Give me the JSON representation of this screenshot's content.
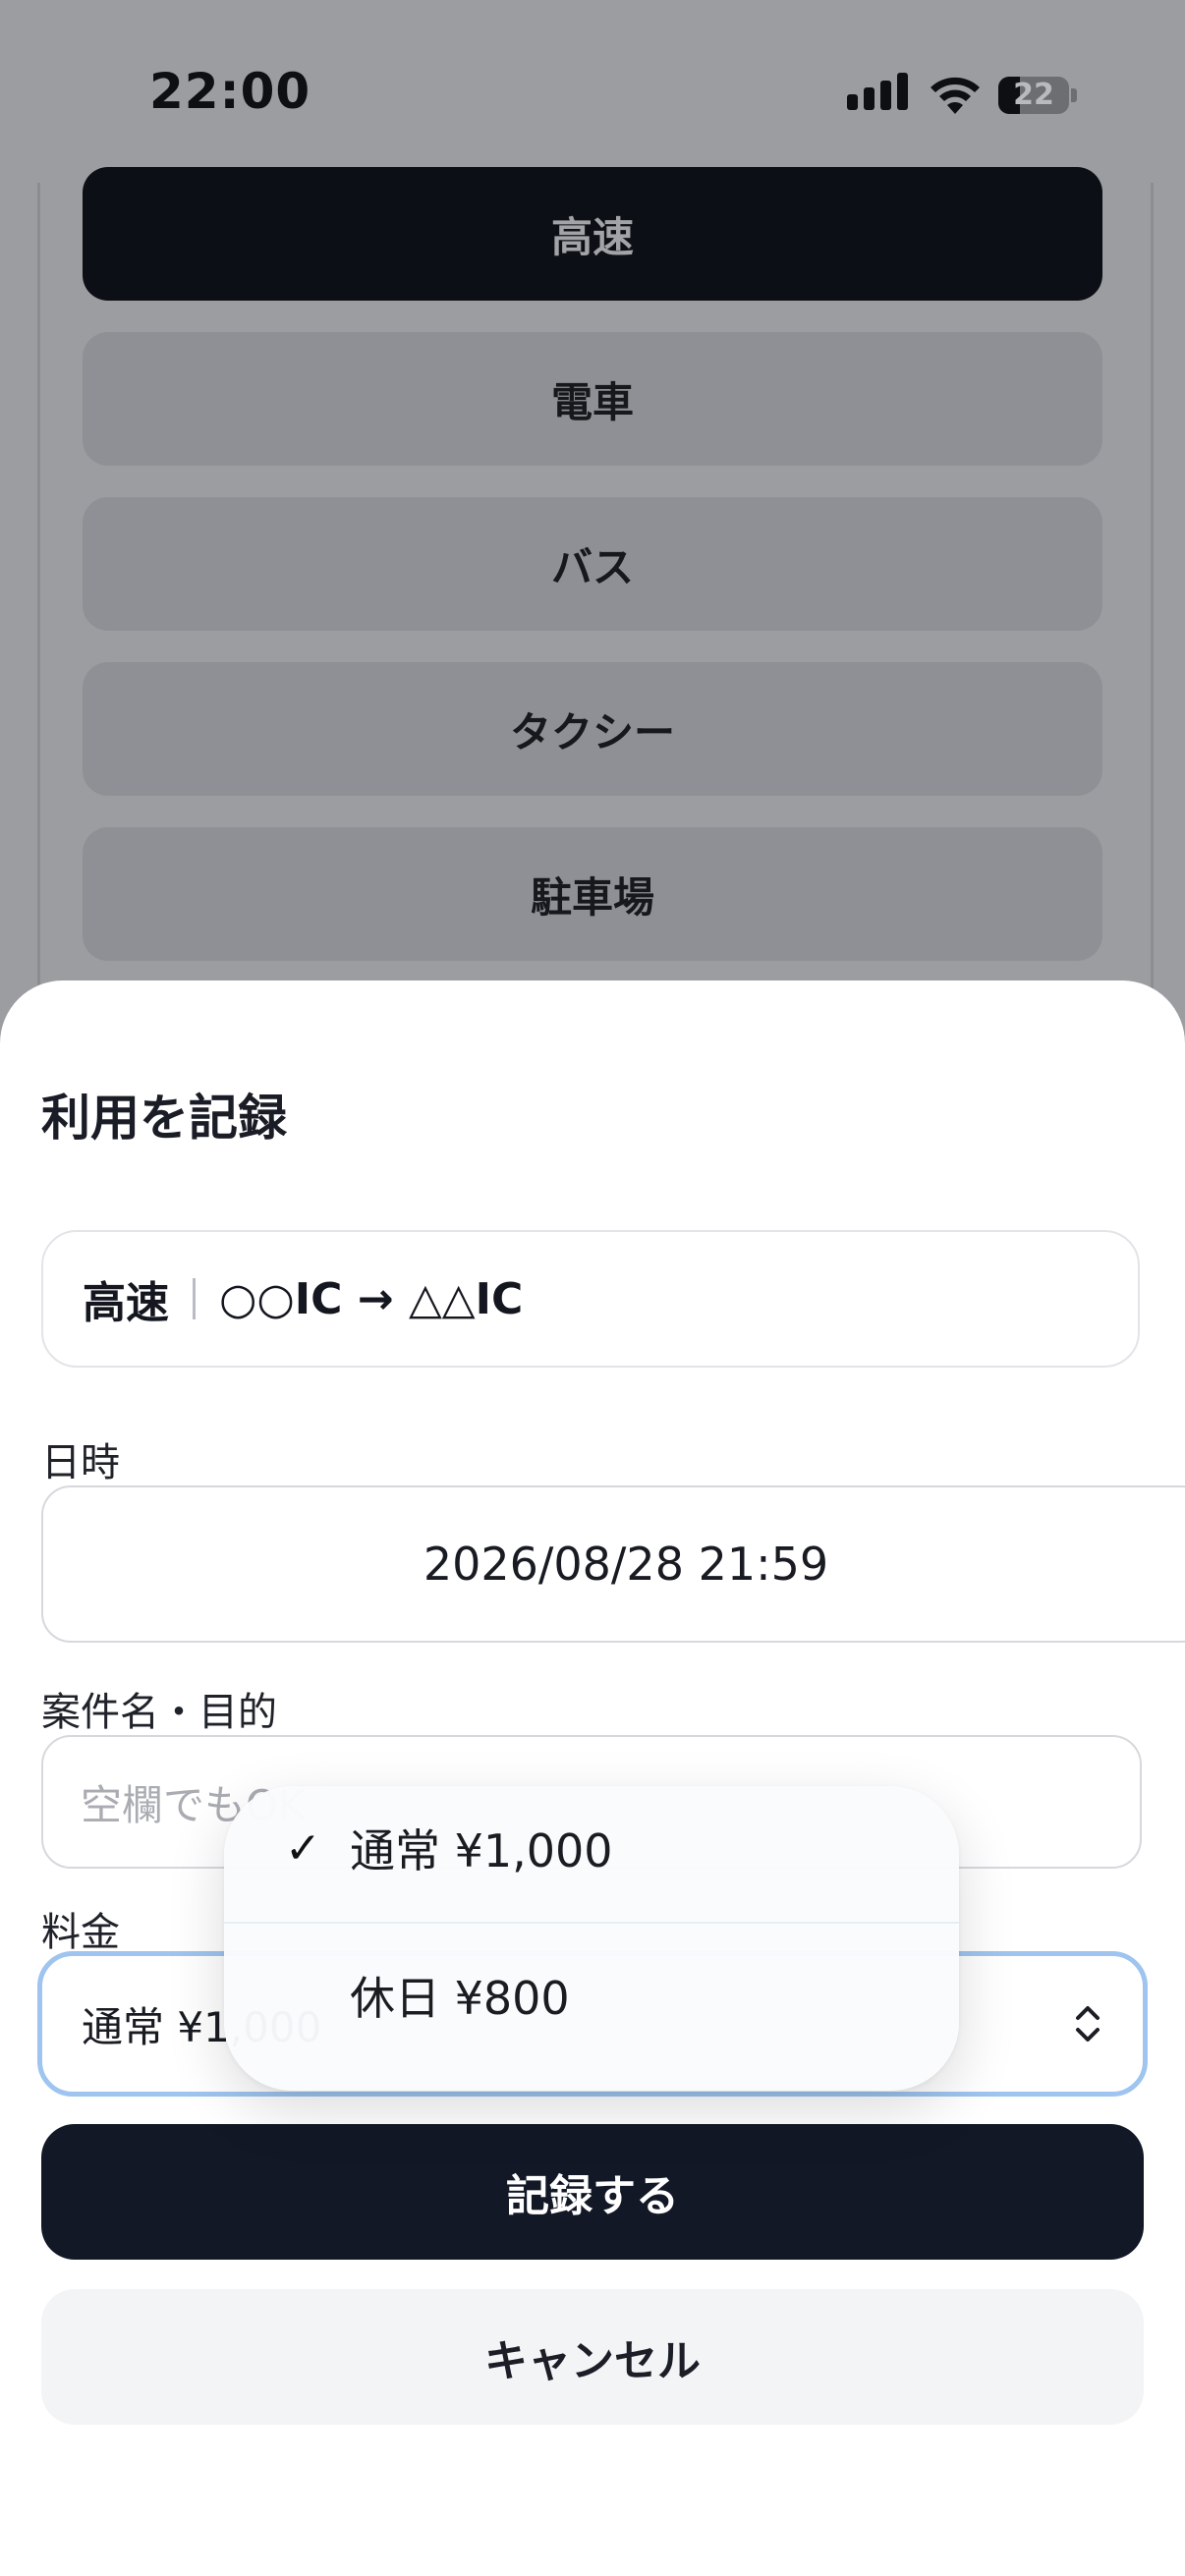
{
  "status_bar": {
    "time": "22:00",
    "battery_level": "22",
    "icons": [
      "signal-icon",
      "wifi-icon",
      "battery-icon"
    ]
  },
  "background": {
    "mode_buttons": [
      {
        "label": "高速",
        "active": true
      },
      {
        "label": "電車",
        "active": false
      },
      {
        "label": "バス",
        "active": false
      },
      {
        "label": "タクシー",
        "active": false
      },
      {
        "label": "駐車場",
        "active": false
      }
    ]
  },
  "sheet": {
    "title": "利用を記録",
    "route": {
      "type": "高速",
      "path": "○○IC → △△IC"
    },
    "datetime": {
      "label": "日時",
      "value": "2026/08/28 21:59"
    },
    "purpose": {
      "label": "案件名・目的",
      "placeholder": "空欄でもOK"
    },
    "fare": {
      "label": "料金",
      "selected": "通常 ¥1,000"
    },
    "record_button": "記録する",
    "cancel_button": "キャンセル"
  },
  "dropdown": {
    "options": [
      {
        "label": "通常 ¥1,000",
        "selected": true
      },
      {
        "label": "休日 ¥800",
        "selected": false
      }
    ],
    "check_mark": "✓"
  },
  "colors": {
    "overlay": "#9c9da1",
    "primary": "#121826",
    "focus_ring": "#9ec4ef"
  }
}
